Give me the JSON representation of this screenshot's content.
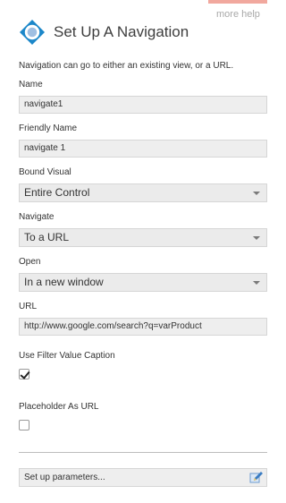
{
  "help": {
    "link_label": "more help"
  },
  "header": {
    "title": "Set Up A Navigation",
    "icon": "navigation-compass-icon"
  },
  "intro": "Navigation can go to either an existing view, or a URL.",
  "name": {
    "label": "Name",
    "value": "navigate1"
  },
  "friendly_name": {
    "label": "Friendly Name",
    "value": "navigate 1"
  },
  "bound_visual": {
    "label": "Bound Visual",
    "value": "Entire Control"
  },
  "navigate": {
    "label": "Navigate",
    "value": "To a URL"
  },
  "open": {
    "label": "Open",
    "value": "In a new window"
  },
  "url": {
    "label": "URL",
    "value": "http://www.google.com/search?q=varProduct"
  },
  "use_filter_value_caption": {
    "label": "Use Filter Value Caption",
    "checked": true
  },
  "placeholder_as_url": {
    "label": "Placeholder As URL",
    "checked": false
  },
  "setup_parameters": {
    "label": "Set up parameters...",
    "icon": "edit-pencil-icon"
  },
  "colors": {
    "accent_tab": "#f1a89e",
    "icon_blue": "#1c87c9",
    "field_bg": "#eeeeee"
  }
}
